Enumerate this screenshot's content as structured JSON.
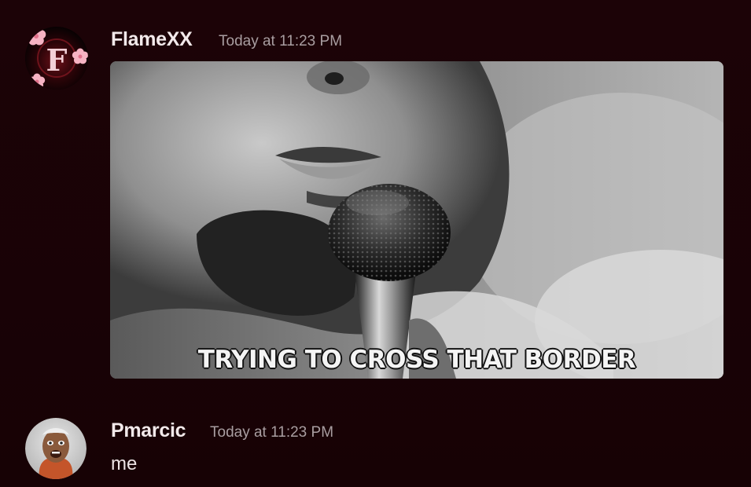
{
  "messages": [
    {
      "username": "FlameXX",
      "timestamp": "Today at 11:23 PM",
      "avatar_icon": "sakura-letter-f-avatar",
      "avatar_letter": "F",
      "gif": {
        "caption": "TRYING TO CROSS THAT BORDER"
      }
    },
    {
      "username": "Pmarcic",
      "timestamp": "Today at 11:23 PM",
      "avatar_icon": "user-photo-avatar",
      "text": "me"
    }
  ],
  "colors": {
    "background": "#1a0306",
    "username": "#f2e9ea",
    "timestamp": "#a99ea1",
    "text": "#ece3e4",
    "sakura": "#f4a7b9"
  }
}
